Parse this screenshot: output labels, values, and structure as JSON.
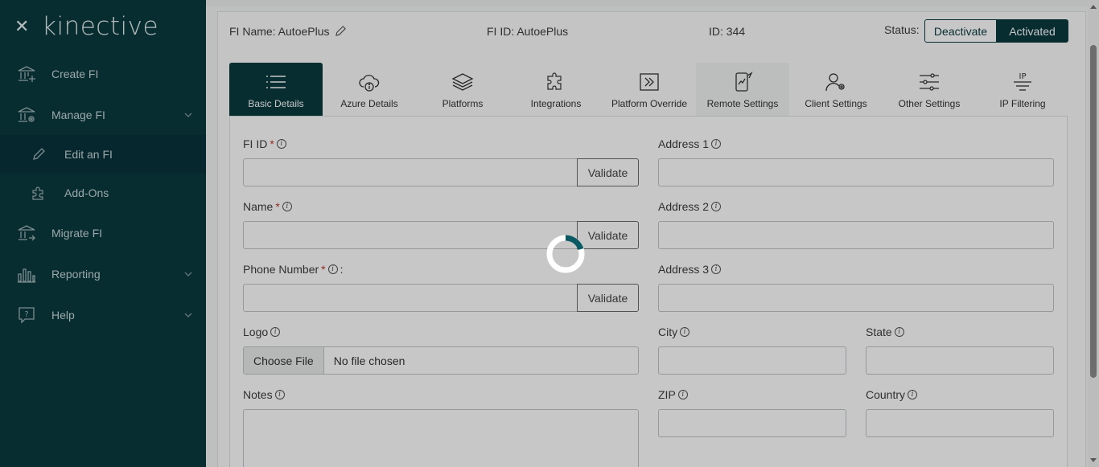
{
  "sidebar": {
    "brand": "kinective",
    "items": [
      {
        "label": "Create FI",
        "icon": "bank-add-icon"
      },
      {
        "label": "Manage FI",
        "icon": "bank-gear-icon",
        "expandable": true
      },
      {
        "label": "Edit an FI",
        "icon": "pencil-icon",
        "sub": true,
        "active": true
      },
      {
        "label": "Add-Ons",
        "icon": "puzzle-icon",
        "sub": true
      },
      {
        "label": "Migrate FI",
        "icon": "bank-arrow-icon"
      },
      {
        "label": "Reporting",
        "icon": "bar-chart-icon",
        "expandable": true
      },
      {
        "label": "Help",
        "icon": "help-icon",
        "expandable": true
      }
    ]
  },
  "header": {
    "fi_name": "FI Name: AutoePlus",
    "fi_id": "FI ID: AutoePlus",
    "id": "ID: 344",
    "status_label": "Status:",
    "deactivate": "Deactivate",
    "activated": "Activated"
  },
  "tabs": [
    {
      "label": "Basic Details",
      "icon": "list-icon"
    },
    {
      "label": "Azure Details",
      "icon": "cloud-info-icon"
    },
    {
      "label": "Platforms",
      "icon": "layers-icon"
    },
    {
      "label": "Integrations",
      "icon": "puzzle-icon"
    },
    {
      "label": "Platform Override",
      "icon": "override-icon"
    },
    {
      "label": "Remote Settings",
      "icon": "remote-icon"
    },
    {
      "label": "Client Settings",
      "icon": "user-gear-icon"
    },
    {
      "label": "Other Settings",
      "icon": "sliders-icon"
    },
    {
      "label": "IP Filtering",
      "icon": "ip-filter-icon"
    }
  ],
  "form": {
    "fi_id_label": "FI ID",
    "name_label": "Name",
    "phone_label": "Phone Number",
    "phone_suffix": ":",
    "logo_label": "Logo",
    "notes_label": "Notes",
    "address1_label": "Address 1",
    "address2_label": "Address 2",
    "address3_label": "Address 3",
    "city_label": "City",
    "state_label": "State",
    "zip_label": "ZIP",
    "country_label": "Country",
    "validate": "Validate",
    "choose_file": "Choose File",
    "no_file": "No file chosen",
    "required": "*",
    "info": "i"
  },
  "colors": {
    "brand": "#0b3a3f",
    "required": "#c0392b"
  }
}
